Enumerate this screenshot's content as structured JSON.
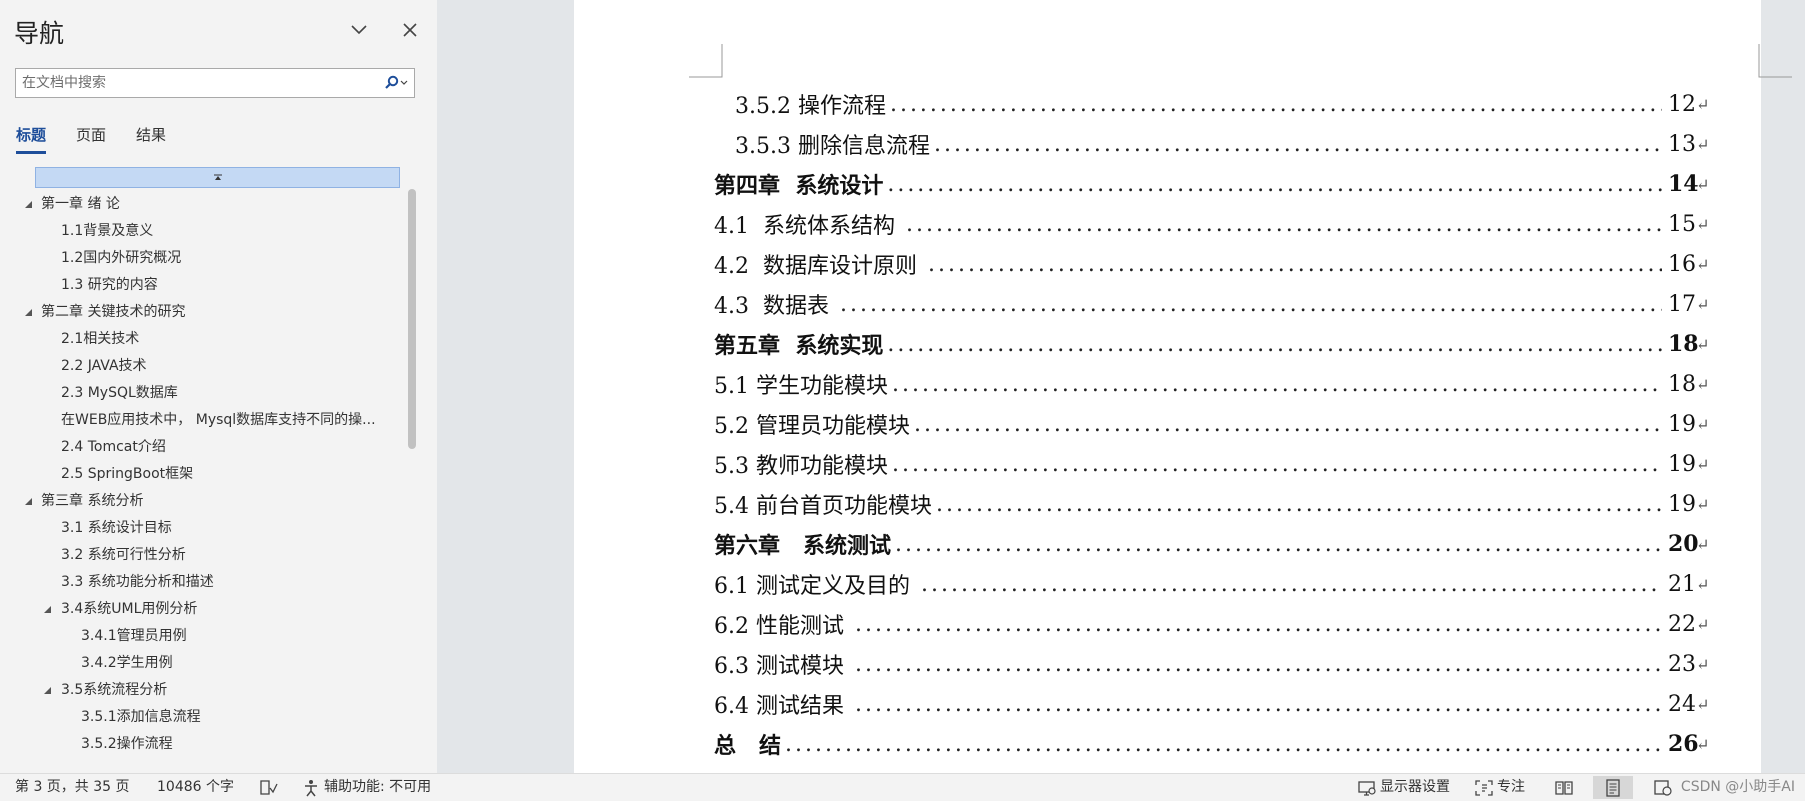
{
  "nav": {
    "title": "导航",
    "search_placeholder": "在文档中搜索",
    "tabs": [
      "标题",
      "页面",
      "结果"
    ],
    "tree": [
      {
        "label": "第一章 绪 论",
        "level": 1,
        "expanded": true
      },
      {
        "label": "1.1背景及意义",
        "level": 2
      },
      {
        "label": "1.2国内外研究概况",
        "level": 2
      },
      {
        "label": "1.3 研究的内容",
        "level": 2
      },
      {
        "label": "第二章 关键技术的研究",
        "level": 1,
        "expanded": true
      },
      {
        "label": "2.1相关技术",
        "level": 2
      },
      {
        "label": "2.2 JAVA技术",
        "level": 2
      },
      {
        "label": "2.3 MySQL数据库",
        "level": 2
      },
      {
        "label": "在WEB应用技术中， Mysql数据库支持不同的操...",
        "level": 2
      },
      {
        "label": "2.4 Tomcat介绍",
        "level": 2
      },
      {
        "label": "2.5 SpringBoot框架",
        "level": 2
      },
      {
        "label": "第三章 系统分析",
        "level": 1,
        "expanded": true
      },
      {
        "label": "3.1 系统设计目标",
        "level": 2
      },
      {
        "label": "3.2 系统可行性分析",
        "level": 2
      },
      {
        "label": "3.3 系统功能分析和描述",
        "level": 2
      },
      {
        "label": "3.4系统UML用例分析",
        "level": 2,
        "expanded": true
      },
      {
        "label": "3.4.1管理员用例",
        "level": 3
      },
      {
        "label": "3.4.2学生用例",
        "level": 3
      },
      {
        "label": "3.5系统流程分析",
        "level": 2,
        "expanded": true
      },
      {
        "label": "3.5.1添加信息流程",
        "level": 3
      },
      {
        "label": "3.5.2操作流程",
        "level": 3
      }
    ]
  },
  "toc": [
    {
      "title": "   3.5.2 操作流程",
      "page": "12",
      "bold": false
    },
    {
      "title": "   3.5.3 删除信息流程",
      "page": "13",
      "bold": false
    },
    {
      "title": "第四章  系统设计",
      "page": "14",
      "bold": true
    },
    {
      "title": "4.1  系统体系结构 ",
      "page": "15",
      "bold": false
    },
    {
      "title": "4.2  数据库设计原则 ",
      "page": "16",
      "bold": false
    },
    {
      "title": "4.3  数据表 ",
      "page": "17",
      "bold": false
    },
    {
      "title": "第五章  系统实现",
      "page": "18",
      "bold": true
    },
    {
      "title": "5.1 学生功能模块",
      "page": "18",
      "bold": false
    },
    {
      "title": "5.2 管理员功能模块",
      "page": "19",
      "bold": false
    },
    {
      "title": "5.3 教师功能模块",
      "page": "19",
      "bold": false
    },
    {
      "title": "5.4 前台首页功能模块",
      "page": "19",
      "bold": false
    },
    {
      "title": "第六章   系统测试",
      "page": "20",
      "bold": true
    },
    {
      "title": "6.1 测试定义及目的 ",
      "page": "21",
      "bold": false
    },
    {
      "title": "6.2 性能测试 ",
      "page": "22",
      "bold": false
    },
    {
      "title": "6.3 测试模块 ",
      "page": "23",
      "bold": false
    },
    {
      "title": "6.4 测试结果 ",
      "page": "24",
      "bold": false
    },
    {
      "title": "总   结",
      "page": "26",
      "bold": true
    }
  ],
  "status": {
    "page_info": "第 3 页，共 35 页",
    "word_count": "10486 个字",
    "accessibility": "辅助功能: 不可用",
    "display_settings": "显示器设置",
    "focus": "专注",
    "watermark": "CSDN @小助手AI"
  },
  "colors": {
    "accent": "#1e4e9a",
    "nav_bg": "#f3f3f3",
    "collapse_bar": "#c4d9f4",
    "doc_bg": "#e3e6e9"
  }
}
